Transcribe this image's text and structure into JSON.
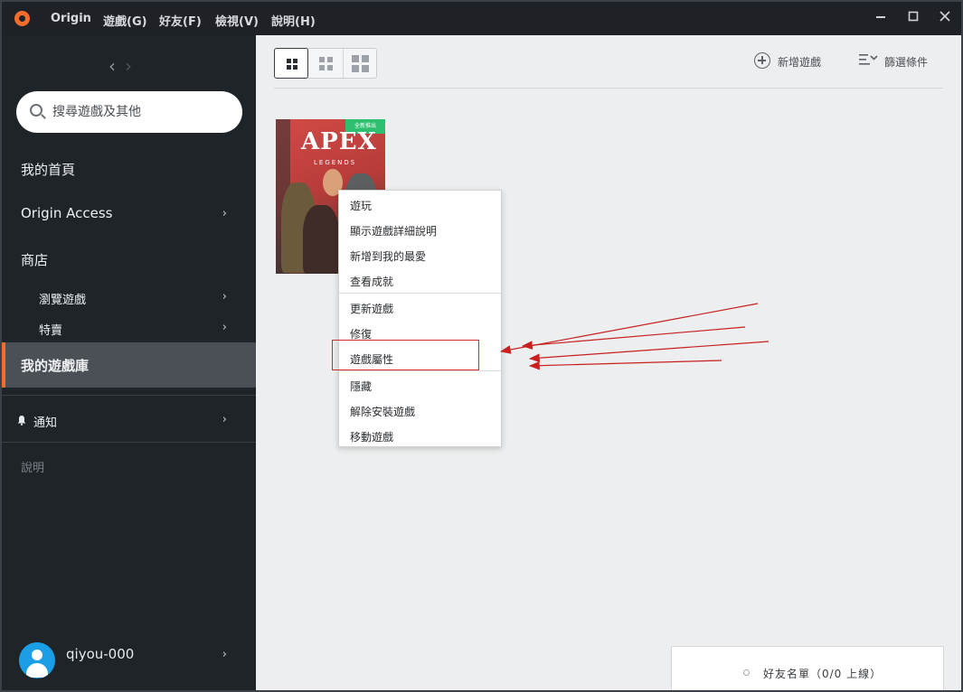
{
  "titlebar": {
    "app_name": "Origin",
    "menus": [
      "遊戲(G)",
      "好友(F)",
      "檢視(V)",
      "說明(H)"
    ],
    "controls": [
      "minimize-icon",
      "maximize-icon",
      "close-icon"
    ]
  },
  "sidebar": {
    "search_placeholder": "搜尋遊戲及其他",
    "items": [
      {
        "label": "我的首頁"
      },
      {
        "label": "Origin Access"
      },
      {
        "label": "商店"
      },
      {
        "label": "瀏覽遊戲"
      },
      {
        "label": "特賣"
      },
      {
        "label": "我的遊戲庫"
      }
    ],
    "notifications": "通知",
    "help": "說明",
    "username": "qiyou-000"
  },
  "toolbar": {
    "add_game": "新增遊戲",
    "filter": "篩選條件"
  },
  "game_tile": {
    "title": "APEX",
    "subtitle": "LEGENDS",
    "badge": "全新推出"
  },
  "context_menu": {
    "group1": [
      "遊玩",
      "顯示遊戲詳細說明",
      "新增到我的最愛",
      "查看成就"
    ],
    "group2": [
      "更新遊戲",
      "修復",
      "遊戲屬性"
    ],
    "group3": [
      "隱藏",
      "解除安裝遊戲",
      "移動遊戲"
    ],
    "highlighted": "遊戲屬性"
  },
  "friends_bar": {
    "label": "好友名單（0/0 上線）"
  },
  "colors": {
    "accent": "#f56c2d",
    "sidebar_bg": "#1f2429",
    "annotation": "#d42a2a"
  }
}
